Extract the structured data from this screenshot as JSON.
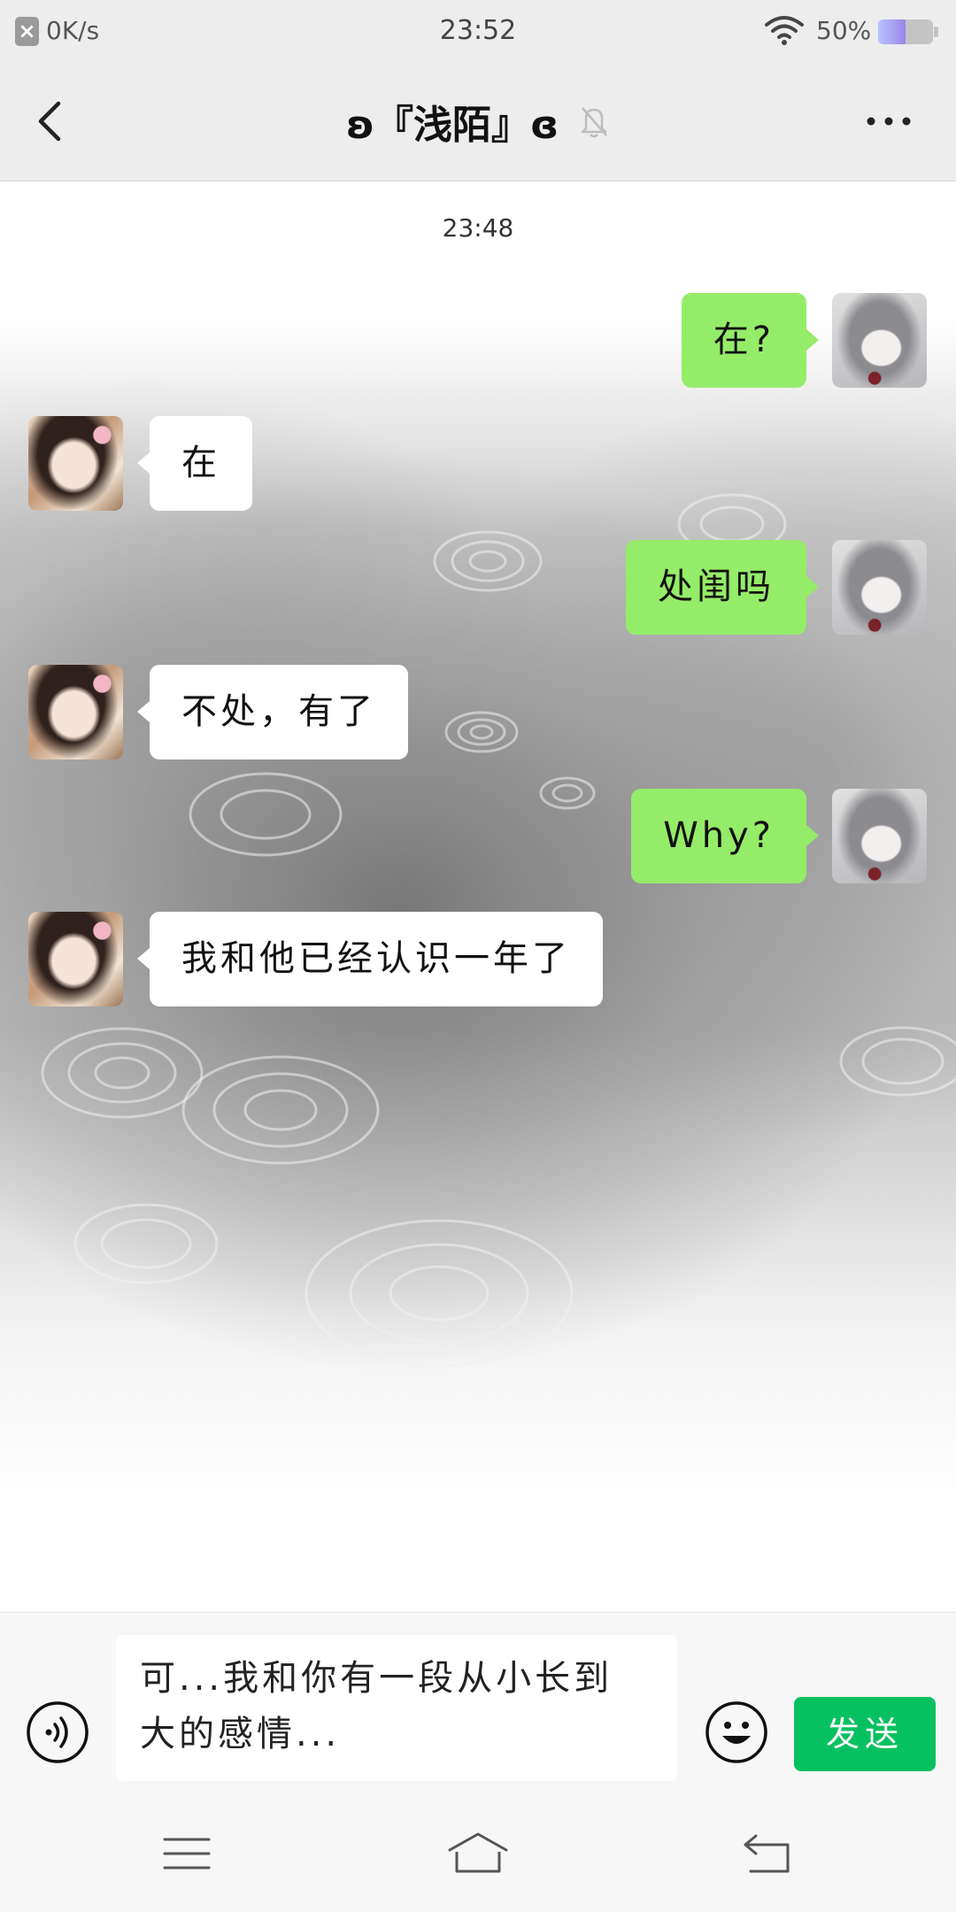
{
  "status_bar": {
    "net_speed": "0K/s",
    "time": "23:52",
    "battery_percent": "50%",
    "battery_level": 0.5,
    "icons": {
      "net": "close-box-icon",
      "wifi": "wifi-icon",
      "battery": "battery-icon"
    }
  },
  "header": {
    "title": "ʚ『浅陌』ɞ",
    "icons": {
      "back": "back-arrow-icon",
      "mute": "mute-bell-icon",
      "more": "more-icon"
    }
  },
  "chat": {
    "timestamp": "23:48",
    "messages": [
      {
        "side": "right",
        "text": "在?"
      },
      {
        "side": "left",
        "text": "在"
      },
      {
        "side": "right",
        "text": "处闺吗"
      },
      {
        "side": "left",
        "text": "不处，有了"
      },
      {
        "side": "right",
        "text": "Why?"
      },
      {
        "side": "left",
        "text": "我和他已经认识一年了"
      }
    ]
  },
  "input_bar": {
    "draft": "可...我和你有一段从小长到大的感情...",
    "send_label": "发送",
    "icons": {
      "voice": "voice-icon",
      "emoji": "emoji-icon"
    }
  },
  "nav_bar": {
    "icons": [
      "menu-icon",
      "home-icon",
      "back-icon"
    ]
  },
  "colors": {
    "header_bg": "#ededed",
    "sent_bubble": "#95ec69",
    "received_bubble": "#ffffff",
    "send_button": "#07c160",
    "input_bar_bg": "#f7f7f7"
  }
}
